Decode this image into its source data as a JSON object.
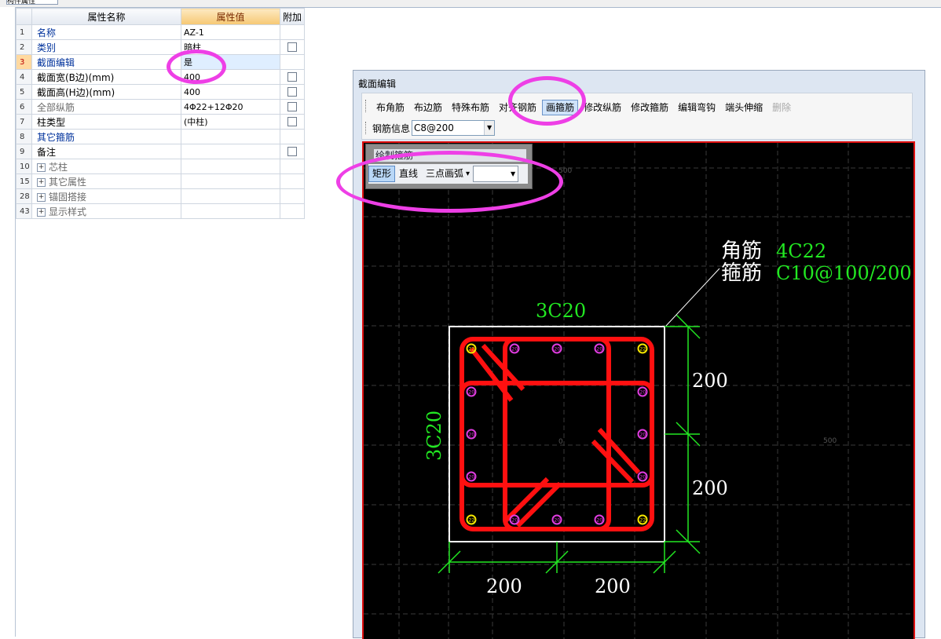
{
  "top_tab_label": "构件属性",
  "grid": {
    "headers": {
      "name": "属性名称",
      "value": "属性值",
      "extra": "附加"
    },
    "rows": [
      {
        "num": "1",
        "name": "名称",
        "value": "AZ-1",
        "name_style": "blue",
        "checkbox": false,
        "expand": false
      },
      {
        "num": "2",
        "name": "类别",
        "value": "暗柱",
        "name_style": "blue",
        "checkbox": true,
        "expand": false
      },
      {
        "num": "3",
        "name": "截面编辑",
        "value": "是",
        "name_style": "blue",
        "checkbox": false,
        "expand": false,
        "selected": true
      },
      {
        "num": "4",
        "name": "截面宽(B边)(mm)",
        "value": "400",
        "name_style": "normal",
        "checkbox": true,
        "expand": false
      },
      {
        "num": "5",
        "name": "截面高(H边)(mm)",
        "value": "400",
        "name_style": "normal",
        "checkbox": true,
        "expand": false
      },
      {
        "num": "6",
        "name": "全部纵筋",
        "value": "4Φ22+12Φ20",
        "name_style": "gray",
        "checkbox": true,
        "expand": false
      },
      {
        "num": "7",
        "name": "柱类型",
        "value": "(中柱)",
        "name_style": "normal",
        "checkbox": true,
        "expand": false
      },
      {
        "num": "8",
        "name": "其它箍筋",
        "value": "",
        "name_style": "blue",
        "checkbox": false,
        "expand": false
      },
      {
        "num": "9",
        "name": "备注",
        "value": "",
        "name_style": "normal",
        "checkbox": true,
        "expand": false
      },
      {
        "num": "10",
        "name": "芯柱",
        "value": "",
        "name_style": "gray",
        "checkbox": false,
        "expand": true
      },
      {
        "num": "15",
        "name": "其它属性",
        "value": "",
        "name_style": "gray",
        "checkbox": false,
        "expand": true
      },
      {
        "num": "28",
        "name": "锚固搭接",
        "value": "",
        "name_style": "gray",
        "checkbox": false,
        "expand": true
      },
      {
        "num": "43",
        "name": "显示样式",
        "value": "",
        "name_style": "gray",
        "checkbox": false,
        "expand": true
      }
    ]
  },
  "dialog": {
    "title": "截面编辑",
    "toolbar": [
      {
        "label": "布角筋"
      },
      {
        "label": "布边筋"
      },
      {
        "label": "特殊布筋"
      },
      {
        "label": "对齐钢筋"
      },
      {
        "label": "画箍筋",
        "active": true
      },
      {
        "label": "修改纵筋"
      },
      {
        "label": "修改箍筋"
      },
      {
        "label": "编辑弯钩"
      },
      {
        "label": "端头伸缩"
      },
      {
        "label": "删除",
        "disabled": true
      }
    ],
    "rebar_info_label": "钢筋信息",
    "rebar_info_value": "C8@200",
    "hoop_panel": {
      "title": "绘制箍筋",
      "buttons": [
        {
          "label": "矩形",
          "active": true
        },
        {
          "label": "直线"
        },
        {
          "label": "三点画弧"
        }
      ],
      "combo_value": ""
    }
  },
  "cad": {
    "corner_label": "角筋",
    "corner_value": "4C22",
    "stirrup_label": "箍筋",
    "stirrup_value": "C10@100/200",
    "top_side_label": "3C20",
    "left_side_label": "3C20",
    "dim_right_1": "200",
    "dim_right_2": "200",
    "dim_bottom_1": "200",
    "dim_bottom_2": "200",
    "rebar_tag": "22",
    "side_rebar_tag": "20",
    "axis_origin": "0",
    "axis_right": "500",
    "axis_top": "500",
    "colors": {
      "rebar": "#ff1010",
      "dimension": "#22e822",
      "text_white": "#ffffff",
      "corner_bar": "#f5e600",
      "side_bar": "#e03ce0",
      "highlight": "#ee3fe6"
    }
  }
}
